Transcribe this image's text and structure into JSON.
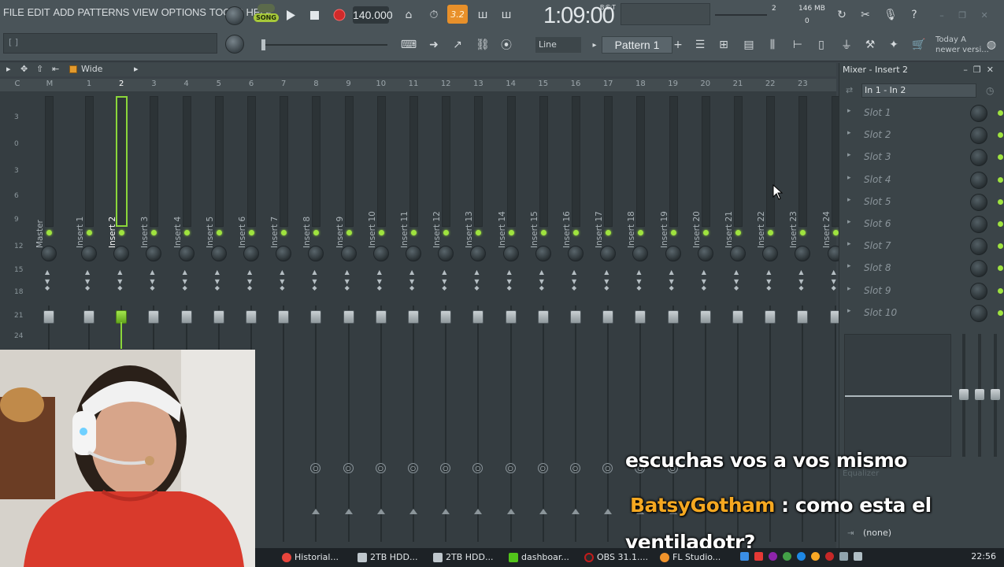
{
  "menu": [
    "FILE",
    "EDIT",
    "ADD",
    "PATTERNS",
    "VIEW",
    "OPTIONS",
    "TOOLS",
    "HELP"
  ],
  "hint": "[ ]",
  "transport": {
    "song_mode": "SONG",
    "pat_mode": "PAT",
    "tempo": "140.000",
    "time": "1:09:00",
    "time_unit": "B:S:T",
    "step_value": "3.2",
    "cpu_count": "2",
    "memory": "146 MB",
    "poly": "0"
  },
  "toolbar2": {
    "snap": "Line",
    "pattern": "Pattern 1",
    "news_line1": "Today  A",
    "news_line2": "newer versi..."
  },
  "mixer": {
    "view_label": "Wide",
    "ruler": [
      "C",
      "M",
      "1",
      "2",
      "3",
      "4",
      "5",
      "6",
      "7",
      "8",
      "9",
      "10",
      "11",
      "12",
      "13",
      "14",
      "15",
      "16",
      "17",
      "18",
      "19",
      "20",
      "21",
      "22",
      "23"
    ],
    "db_scale": [
      "3",
      "0",
      "3",
      "6",
      "9",
      "12",
      "15",
      "18",
      "21",
      "24"
    ],
    "tracks": [
      "Master",
      "Insert 1",
      "Insert 2",
      "Insert 3",
      "Insert 4",
      "Insert 5",
      "Insert 6",
      "Insert 7",
      "Insert 8",
      "Insert 9",
      "Insert 10",
      "Insert 11",
      "Insert 12",
      "Insert 13",
      "Insert 14",
      "Insert 15",
      "Insert 16",
      "Insert 17",
      "Insert 18",
      "Insert 19",
      "Insert 20",
      "Insert 21",
      "Insert 22",
      "Insert 23",
      "Insert 24"
    ],
    "selected_track": "Insert 2"
  },
  "panel": {
    "title": "Mixer - Insert 2",
    "routing": "In 1 - In 2",
    "slots": [
      "Slot 1",
      "Slot 2",
      "Slot 3",
      "Slot 4",
      "Slot 5",
      "Slot 6",
      "Slot 7",
      "Slot 8",
      "Slot 9",
      "Slot 10"
    ],
    "eq_label": "Equalizer",
    "output": "(none)"
  },
  "chat": {
    "line1": "escuchas vos a vos mismo",
    "user": "BatsyGotham",
    "line2": " : como esta el",
    "line3": "ventiladotr?"
  },
  "taskbar": {
    "items": [
      "Historial...",
      "2TB HDD...",
      "2TB HDD...",
      "dashboar...",
      "OBS 31.1....",
      "FL Studio..."
    ],
    "clock": "22:56"
  },
  "colors": {
    "accent_green": "#9fe33f",
    "record_red": "#d12a2a",
    "chat_user": "#f5a821"
  }
}
